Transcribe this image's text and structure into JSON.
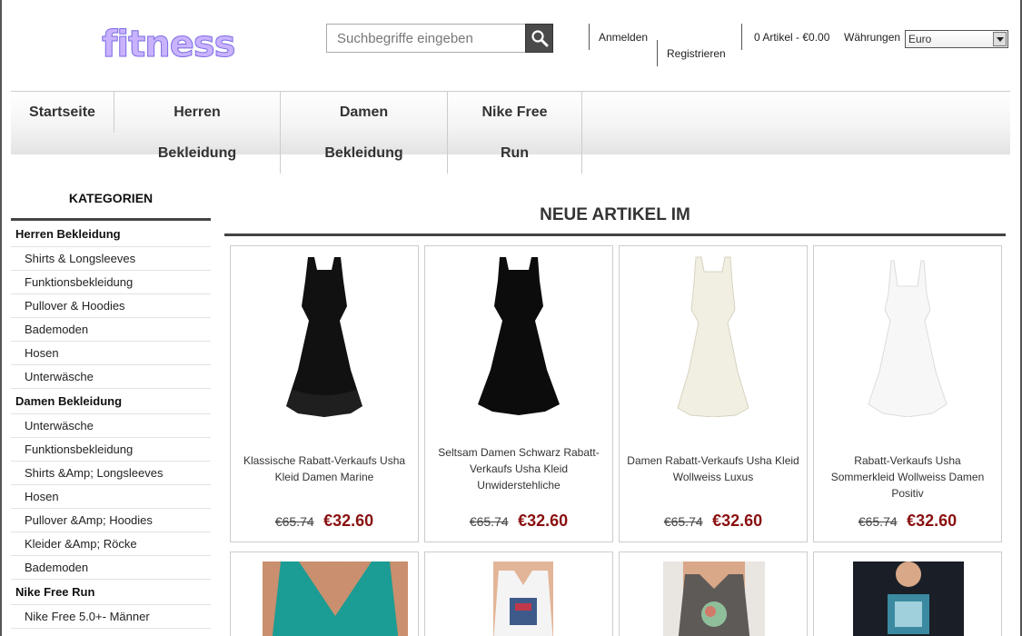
{
  "header": {
    "logo": "fitness",
    "search_placeholder": "Suchbegriffe eingeben",
    "login": "Anmelden",
    "register": "Registrieren",
    "cart": "0 Artikel - €0.00",
    "currency_label": "Währungen",
    "currency_value": "Euro"
  },
  "nav": {
    "items": [
      {
        "line1": "Startseite",
        "line2": ""
      },
      {
        "line1": "Herren",
        "line2": "Bekleidung"
      },
      {
        "line1": "Damen",
        "line2": "Bekleidung"
      },
      {
        "line1": "Nike Free",
        "line2": "Run"
      }
    ]
  },
  "sidebar": {
    "title": "KATEGORIEN",
    "groups": [
      {
        "head": "Herren Bekleidung",
        "items": [
          "Shirts & Longsleeves",
          "Funktionsbekleidung",
          "Pullover & Hoodies",
          "Bademoden",
          "Hosen",
          "Unterwäsche"
        ]
      },
      {
        "head": "Damen Bekleidung",
        "items": [
          "Unterwäsche",
          "Funktionsbekleidung",
          "Shirts &Amp; Longsleeves",
          "Hosen",
          "Pullover &Amp; Hoodies",
          "Kleider &Amp; Röcke",
          "Bademoden"
        ]
      },
      {
        "head": "Nike Free Run",
        "items": [
          "Nike Free 5.0+- Männer"
        ]
      }
    ]
  },
  "main": {
    "title": "NEUE ARTIKEL IM",
    "products": [
      {
        "name": "Klassische Rabatt-Verkaufs Usha Kleid Damen Marine",
        "old_price": "€65.74",
        "new_price": "€32.60",
        "dress_color": "#111111"
      },
      {
        "name": "Seltsam Damen Schwarz Rabatt-Verkaufs Usha Kleid Unwiderstehliche",
        "old_price": "€65.74",
        "new_price": "€32.60",
        "dress_color": "#0c0c0c"
      },
      {
        "name": "Damen Rabatt-Verkaufs Usha Kleid Wollweiss Luxus",
        "old_price": "€65.74",
        "new_price": "€32.60",
        "dress_color": "#f1eee2"
      },
      {
        "name": "Rabatt-Verkaufs Usha Sommerkleid Wollweiss Damen Positiv",
        "old_price": "€65.74",
        "new_price": "€32.60",
        "dress_color": "#f7f7f7"
      }
    ]
  },
  "colors": {
    "price": "#8a1010",
    "logo_fill": "#c9b3ff"
  }
}
